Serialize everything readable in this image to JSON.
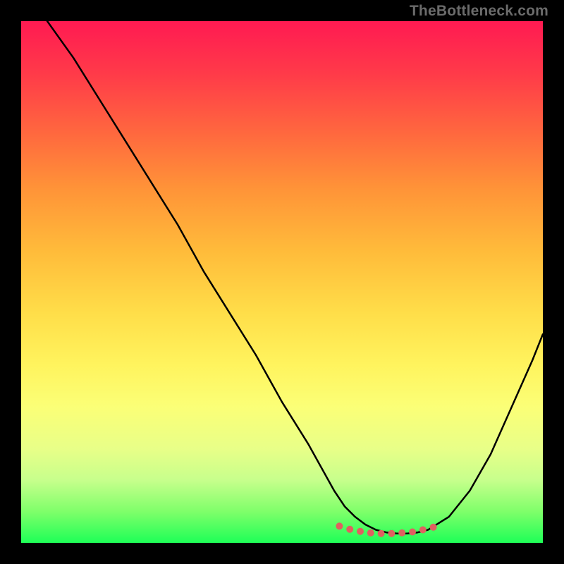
{
  "watermark": "TheBottleneck.com",
  "chart_data": {
    "type": "line",
    "title": "",
    "xlabel": "",
    "ylabel": "",
    "xlim": [
      0,
      100
    ],
    "ylim": [
      0,
      100
    ],
    "grid": false,
    "legend": false,
    "series": [
      {
        "name": "curve",
        "color": "#000000",
        "x": [
          5,
          10,
          15,
          20,
          25,
          30,
          35,
          40,
          45,
          50,
          55,
          60,
          62,
          64,
          66,
          68,
          70,
          72,
          74,
          76,
          78,
          82,
          86,
          90,
          94,
          98,
          100
        ],
        "y": [
          100,
          93,
          85,
          77,
          69,
          61,
          52,
          44,
          36,
          27,
          19,
          10,
          7,
          5,
          3.5,
          2.5,
          2,
          1.8,
          1.8,
          2,
          2.5,
          5,
          10,
          17,
          26,
          35,
          40
        ]
      },
      {
        "name": "dots",
        "type": "scatter",
        "color": "#e06060",
        "x": [
          61,
          63,
          65,
          67,
          69,
          71,
          73,
          75,
          77,
          79
        ],
        "y": [
          3.2,
          2.6,
          2.2,
          1.9,
          1.8,
          1.8,
          1.9,
          2.1,
          2.5,
          3.0
        ]
      }
    ],
    "annotations": []
  }
}
